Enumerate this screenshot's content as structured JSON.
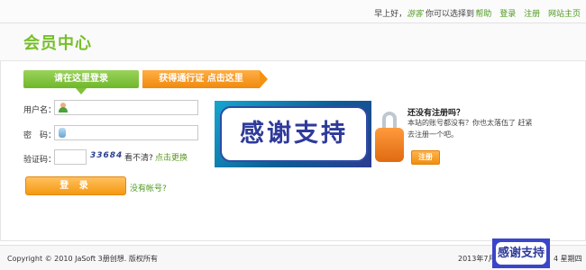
{
  "topbar": {
    "greeting_prefix": "早上好，",
    "username": "游客",
    "greeting_suffix": " 你可以选择到",
    "links": [
      "帮助",
      "登录",
      "注册",
      "网站主页"
    ]
  },
  "header": {
    "title": "会员中心"
  },
  "tabs": {
    "login": "请在这里登录",
    "passport": "获得通行证 点击这里"
  },
  "form": {
    "username_label": "用户名：",
    "password_label": "密　码：",
    "captcha_label": "验证码：",
    "username_value": "",
    "password_value": "",
    "captcha_value": "",
    "captcha_image_text": "33684",
    "cant_see": "看不清?",
    "change": "点击更换",
    "login_button": "登 录",
    "no_account": "没有帐号?"
  },
  "promo": {
    "banner_text": "感谢支持",
    "register_title": "还没有注册吗？",
    "register_desc": "本站的账号都没有？你也太落伍了 赶紧去注册一个吧。",
    "register_button": "注册"
  },
  "footer": {
    "copyright": "Copyright © 2010 JaSoft 3册创想. 版权所有",
    "date": "2013年7月",
    "weekday": "4 星期四",
    "badge_text": "感谢支持"
  },
  "colors": {
    "accent_green": "#76bf2a",
    "accent_orange": "#f59812",
    "link_green": "#4d9a1e"
  }
}
